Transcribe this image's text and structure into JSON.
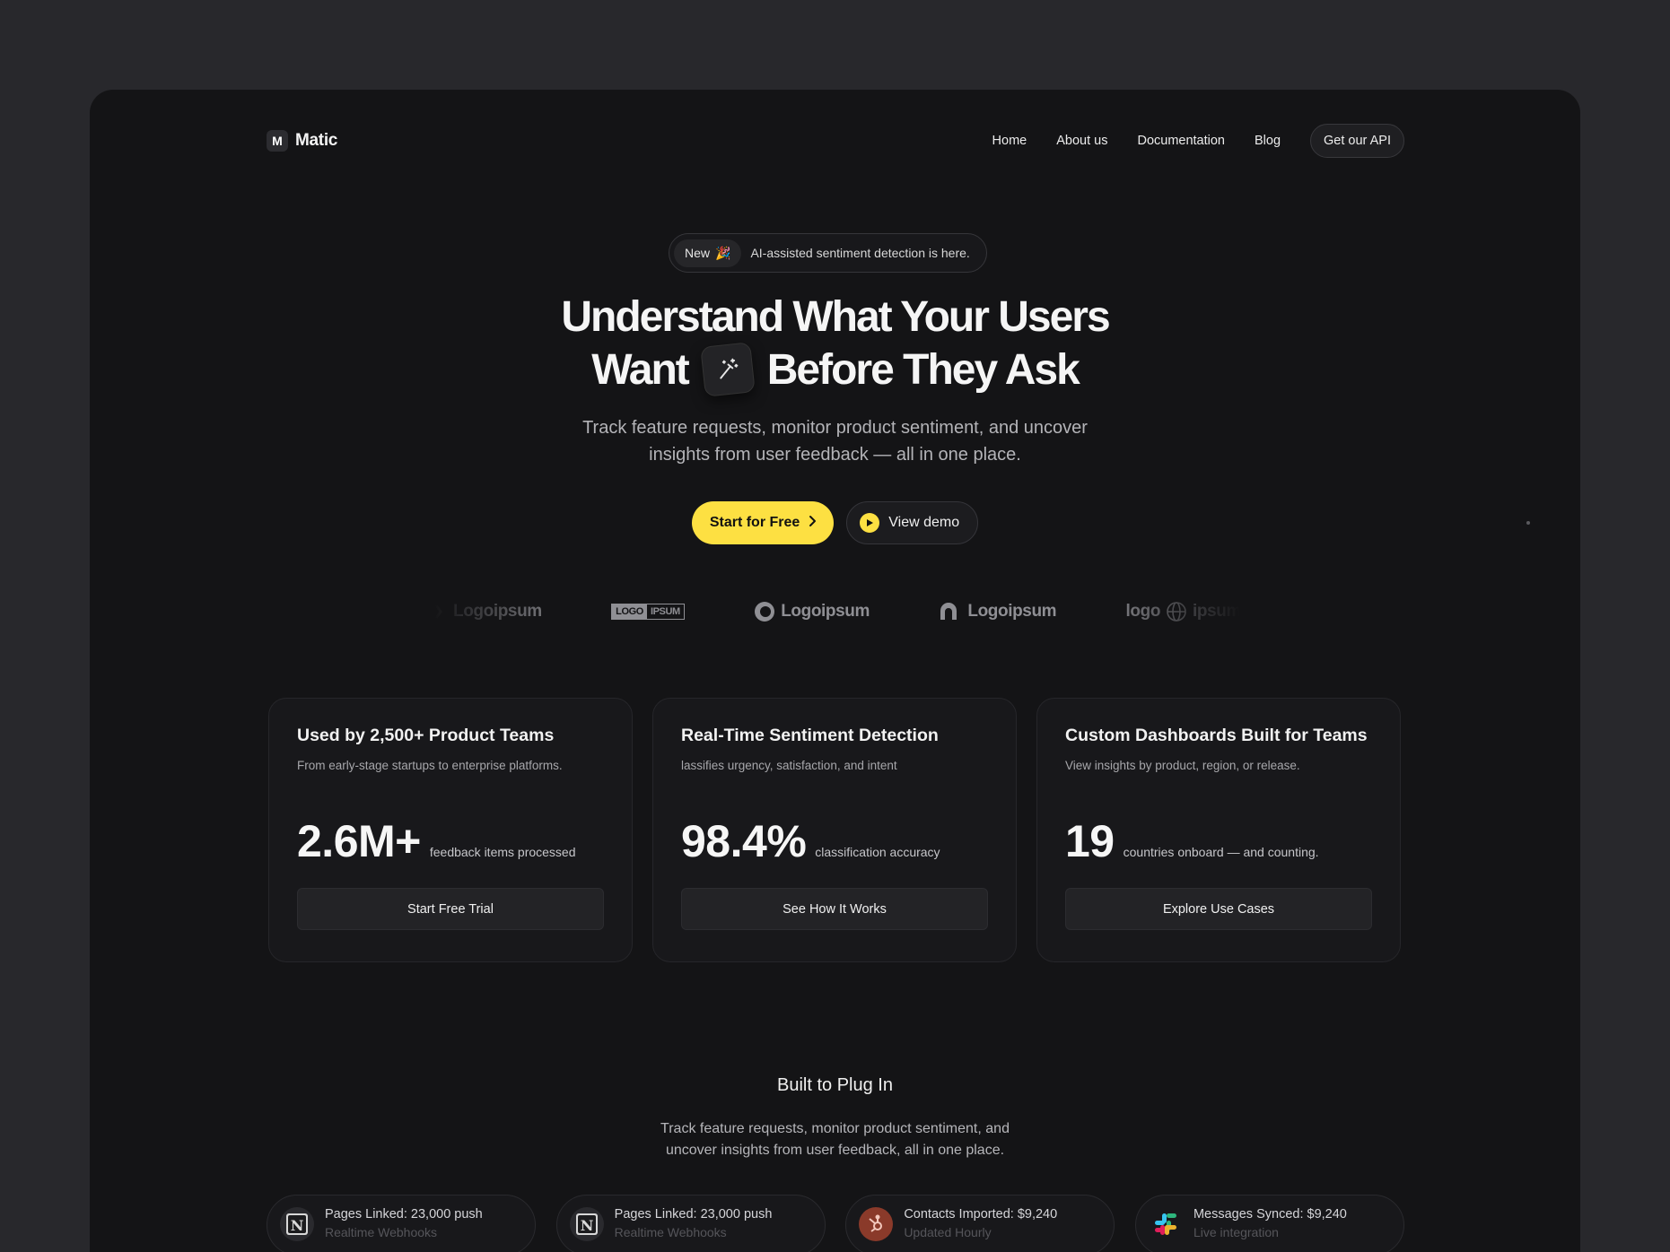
{
  "brand": {
    "mark": "M",
    "name": "Matic"
  },
  "nav": {
    "links": [
      "Home",
      "About us",
      "Documentation",
      "Blog"
    ],
    "api_button": "Get our API"
  },
  "hero": {
    "badge_new": "New",
    "badge_emoji": "🎉",
    "badge_text": "AI-assisted sentiment detection is here.",
    "headline_line1": "Understand What Your Users",
    "headline_line2_a": "Want",
    "headline_line2_b": "Before They Ask",
    "sub_line1": "Track feature requests, monitor product sentiment, and uncover",
    "sub_line2": "insights from user feedback — all in one place.",
    "primary_cta": "Start for Free",
    "secondary_cta": "View demo"
  },
  "logos": [
    "Logoipsum",
    "LOGO",
    "IPSUM",
    "Logoipsum",
    "Logoipsum",
    "logo",
    "ipsum"
  ],
  "cards": [
    {
      "title": "Used by 2,500+ Product Teams",
      "desc": "From early-stage startups to enterprise platforms.",
      "stat": "2.6M+",
      "stat_label": "feedback items processed",
      "button": "Start Free Trial"
    },
    {
      "title": "Real-Time Sentiment Detection",
      "desc": "lassifies urgency, satisfaction, and intent",
      "stat": "98.4%",
      "stat_label": "classification accuracy",
      "button": "See How It Works"
    },
    {
      "title": "Custom Dashboards Built for Teams",
      "desc": "View insights by product, region, or release.",
      "stat": "19",
      "stat_label": "countries onboard — and counting.",
      "button": "Explore Use Cases"
    }
  ],
  "section": {
    "title": "Built to Plug In",
    "sub_line1": "Track feature requests, monitor product sentiment, and",
    "sub_line2": "uncover insights from user feedback, all in one place."
  },
  "integrations": [
    {
      "icon": "notion-icon",
      "title": "Pages Linked: 23,000 push",
      "subtitle": "Realtime Webhooks"
    },
    {
      "icon": "notion-icon",
      "title": "Pages Linked: 23,000 push",
      "subtitle": "Realtime Webhooks"
    },
    {
      "icon": "hubspot-icon",
      "title": "Contacts Imported: $9,240",
      "subtitle": "Updated Hourly"
    },
    {
      "icon": "slack-icon",
      "title": "Messages Synced: $9,240",
      "subtitle": "Live integration"
    }
  ],
  "colors": {
    "accent": "#fde042",
    "background": "#141416",
    "outer": "#28282c"
  }
}
